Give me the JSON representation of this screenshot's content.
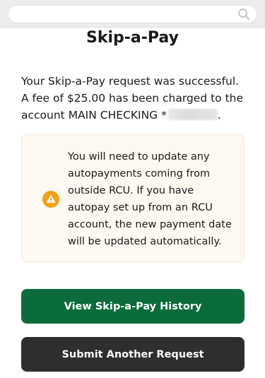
{
  "search": {
    "icon": "search-icon",
    "placeholder": ""
  },
  "page": {
    "title": "Skip-a-Pay"
  },
  "message": {
    "line1": "Your Skip-a-Pay request was successful. A fee of $25.00 has been charged to the account MAIN CHECKING *",
    "end": "."
  },
  "notice": {
    "icon": "warning-icon",
    "text": "You will need to update any autopayments coming from outside RCU. If you have autopay set up from an RCU account, the new payment date will be updated automatically."
  },
  "buttons": {
    "history": "View Skip-a-Pay History",
    "submit_another": "Submit Another Request"
  },
  "colors": {
    "primary_button": "#0b6b3a",
    "secondary_button": "#2e2e2e",
    "warning": "#f0a21a",
    "notice_background": "#fdf9f1"
  }
}
